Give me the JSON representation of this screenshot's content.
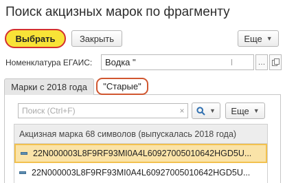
{
  "window": {
    "title": "Поиск акцизных марок по фрагменту"
  },
  "toolbar": {
    "choose_label": "Выбрать",
    "close_label": "Закрыть",
    "more_label": "Еще"
  },
  "nomenclature": {
    "label": "Номенклатура ЕГАИС:",
    "value": "Водка \""
  },
  "tabs": [
    {
      "label": "Марки с 2018 года"
    },
    {
      "label": "\"Старые\""
    }
  ],
  "list_toolbar": {
    "search_placeholder": "Поиск (Ctrl+F)",
    "search_clear": "×",
    "more_label": "Еще"
  },
  "table": {
    "column_header": "Акцизная марка 68 символов (выпускалась 2018 года)",
    "rows": [
      {
        "value": "22N000003L8F9RF93MI0A4L60927005010642HGD5U...",
        "selected": true
      },
      {
        "value": "22N000003L8F9RF93MI0A4L60927005010642HGD5U...",
        "selected": false
      }
    ]
  },
  "colors": {
    "accent_button": "#f8e337",
    "highlight_border": "#d32f2f",
    "selected_row": "#fae3a8"
  }
}
